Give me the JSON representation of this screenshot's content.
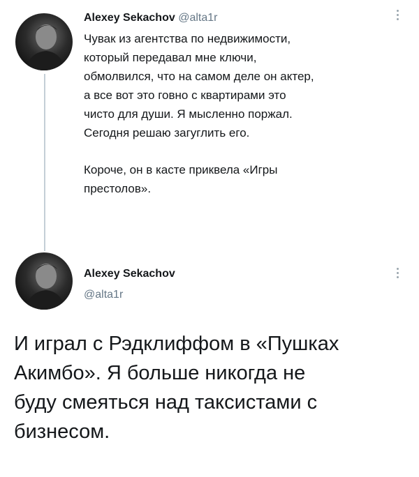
{
  "tweet1": {
    "author_name": "Alexey Sekachov",
    "handle": "@alta1r",
    "paragraphs": [
      "Чувак из агентства по недвижимости,\nкоторый передавал мне ключи,\nобмолвился, что на самом деле он актер,\nа все вот это говно с квартирами это\nчисто для души. Я мысленно поржал.\nСегодня решаю загуглить его.",
      "Короче, он в касте приквела «Игры\nпрестолов»."
    ],
    "icons": {
      "avatar": "profile-photo",
      "menu": "vertical-dots-icon"
    }
  },
  "tweet2": {
    "author_name": "Alexey Sekachov",
    "handle": "@alta1r",
    "text": "И играл с Рэдклиффом в «Пушках\nАкимбо». Я больше никогда не\nбуду смеяться над таксистами с\nбизнесом.",
    "icons": {
      "avatar": "profile-photo",
      "menu": "vertical-dots-icon"
    }
  },
  "colors": {
    "text": "#14171a",
    "secondary_text": "#657786",
    "thread_line": "#c4cfd6",
    "background": "#ffffff"
  }
}
